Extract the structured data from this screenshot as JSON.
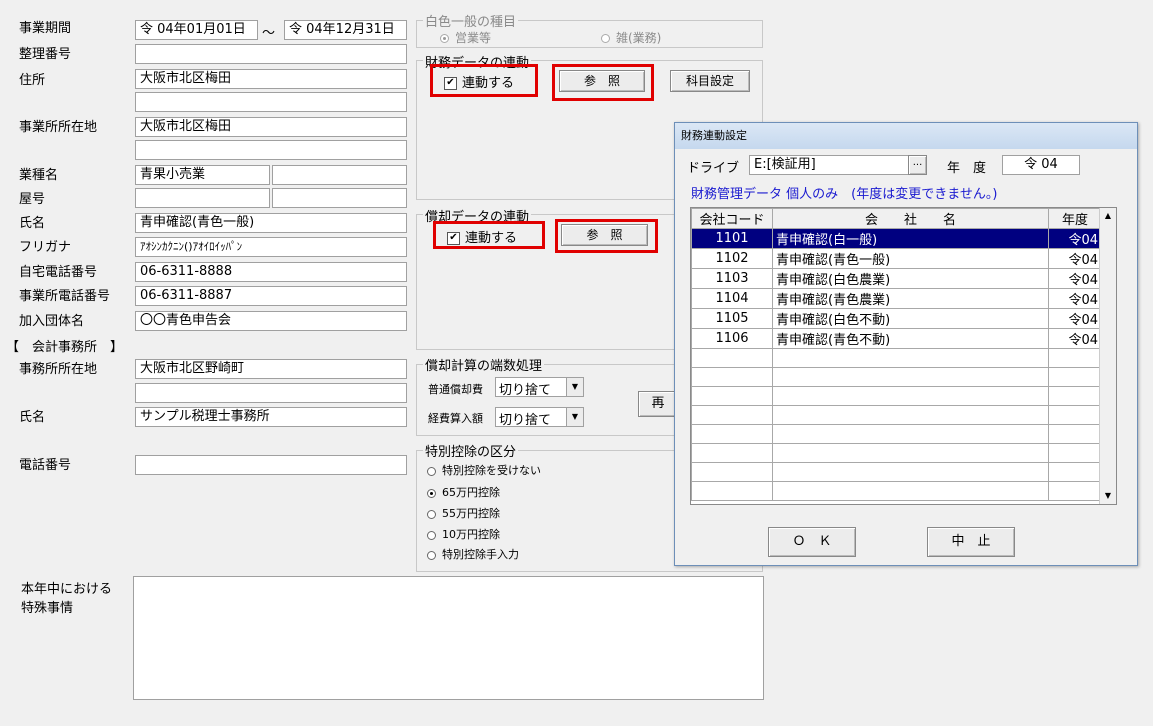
{
  "form": {
    "period_label": "事業期間",
    "period_start": "令 04年01月01日",
    "period_sep": "～",
    "period_end": "令 04年12月31日",
    "ref_no_label": "整理番号",
    "address_label": "住所",
    "address_value": "大阪市北区梅田",
    "office_address_label": "事業所所在地",
    "office_address_value": "大阪市北区梅田",
    "industry_label": "業種名",
    "industry_value": "青果小売業",
    "trade_name_label": "屋号",
    "name_label": "氏名",
    "name_value": "青申確認(青色一般)",
    "kana_label": "フリガナ",
    "kana_value": "ｱｵｼﾝｶｸﾆﾝ()ｱｵｲﾛｲｯﾊﾟﾝ",
    "home_phone_label": "自宅電話番号",
    "home_phone_value": "06-6311-8888",
    "office_phone_label": "事業所電話番号",
    "office_phone_value": "06-6311-8887",
    "org_label": "加入団体名",
    "org_value": "〇〇青色申告会",
    "accountant_section": "【　会計事務所　】",
    "acc_address_label": "事務所所在地",
    "acc_address_value": "大阪市北区野崎町",
    "acc_name_label": "氏名",
    "acc_name_value": "サンプル税理士事務所",
    "acc_phone_label": "電話番号",
    "special_label_1": "本年中における",
    "special_label_2": "特殊事情"
  },
  "white_type": {
    "title": "白色一般の種目",
    "opt1": "営業等",
    "opt2": "雑(業務)"
  },
  "finance_link": {
    "title": "財務データの連動",
    "checkbox_label": "連動する",
    "checked": true,
    "ref_button": "参　照",
    "account_button": "科目設定"
  },
  "depr_link": {
    "title": "償却データの連動",
    "checkbox_label": "連動する",
    "checked": true,
    "ref_button": "参　照"
  },
  "rounding": {
    "title": "償却計算の端数処理",
    "normal_label": "普通償却費",
    "normal_value": "切り捨て",
    "expense_label": "経費算入額",
    "expense_value": "切り捨て",
    "partial_button": "再"
  },
  "deduction": {
    "title": "特別控除の区分",
    "options": [
      "特別控除を受けない",
      "65万円控除",
      "55万円控除",
      "10万円控除",
      "特別控除手入力"
    ],
    "selected_index": 1
  },
  "dialog": {
    "title": "財務連動設定",
    "drive_label": "ドライブ",
    "drive_value": "E:[検証用]",
    "browse_button": "...",
    "year_label": "年　度",
    "year_value": "令 04",
    "info_text": "財務管理データ 個人のみ　(年度は変更できません。)",
    "columns": [
      "会社コード",
      "会　　社　　名",
      "年度"
    ],
    "rows": [
      {
        "code": "1101",
        "name": "青申確認(白一般)",
        "year": "令04"
      },
      {
        "code": "1102",
        "name": "青申確認(青色一般)",
        "year": "令04"
      },
      {
        "code": "1103",
        "name": "青申確認(白色農業)",
        "year": "令04"
      },
      {
        "code": "1104",
        "name": "青申確認(青色農業)",
        "year": "令04"
      },
      {
        "code": "1105",
        "name": "青申確認(白色不動)",
        "year": "令04"
      },
      {
        "code": "1106",
        "name": "青申確認(青色不動)",
        "year": "令04"
      }
    ],
    "selected_row": 0,
    "ok_button": "Ｏ　Ｋ",
    "cancel_button": "中　止"
  }
}
